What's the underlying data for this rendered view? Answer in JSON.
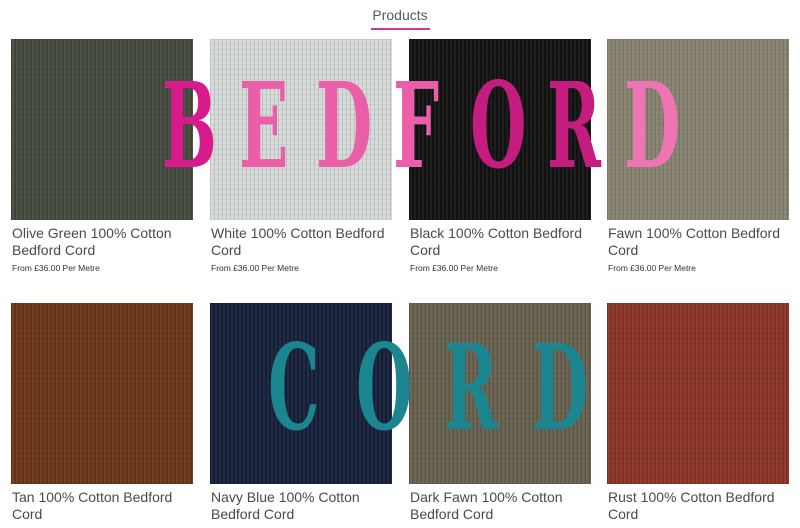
{
  "header": {
    "title": "Products"
  },
  "products": [
    {
      "name": "Olive Green 100% Cotton Bedford Cord",
      "price": "From £36.00 Per Metre",
      "color": "#444a3d"
    },
    {
      "name": "White 100% Cotton Bedford Cord",
      "price": "From £36.00 Per Metre",
      "color": "#d5dad8"
    },
    {
      "name": "Black 100% Cotton Bedford Cord",
      "price": "From £36.00 Per Metre",
      "color": "#121212"
    },
    {
      "name": "Fawn 100% Cotton Bedford Cord",
      "price": "From £36.00 Per Metre",
      "color": "#878370"
    },
    {
      "name": "Tan 100% Cotton Bedford Cord",
      "price": "",
      "color": "#6c3617"
    },
    {
      "name": "Navy Blue 100% Cotton Bedford Cord",
      "price": "",
      "color": "#16203a"
    },
    {
      "name": "Dark Fawn 100% Cotton Bedford Cord",
      "price": "",
      "color": "#67604f"
    },
    {
      "name": "Rust 100% Cotton Bedford Cord",
      "price": "",
      "color": "#8a3425"
    }
  ],
  "overlay": {
    "word1": "BEDFORD",
    "word1_colors": [
      "#d81b8c",
      "#ea5fa8",
      "#ea5fa8",
      "#ea5fa8",
      "#c51c7f",
      "#c51c7f",
      "#f073b3"
    ],
    "word2": "CORD",
    "word2_color": "#1b8590"
  }
}
